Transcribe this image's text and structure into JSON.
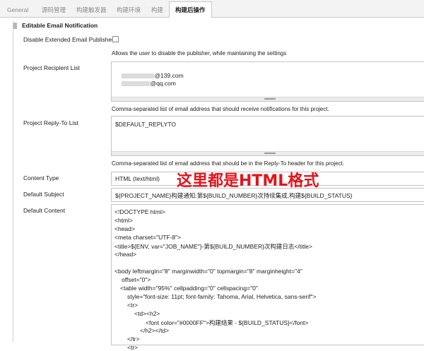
{
  "tabs": [
    {
      "label": "General",
      "active": false
    },
    {
      "label": "源码管理",
      "active": false
    },
    {
      "label": "构建触发器",
      "active": false
    },
    {
      "label": "构建环境",
      "active": false
    },
    {
      "label": "构建",
      "active": false
    },
    {
      "label": "构建后操作",
      "active": true
    }
  ],
  "section_title": "Editable Email Notification",
  "disable_publisher": {
    "label": "Disable Extended Email Publisher",
    "checked": false,
    "help": "Allows the user to disable the publisher, while maintaining the settings"
  },
  "recipient_list": {
    "label": "Project Recipient List",
    "lines": [
      "@139.com",
      "@qq.com"
    ],
    "help": "Comma-separated list of email address that should receive notifications for this project."
  },
  "reply_to": {
    "label": "Project Reply-To List",
    "value": "$DEFAULT_REPLYTO",
    "help": "Comma-separated list of email address that should be in the Reply-To header for this project."
  },
  "content_type": {
    "label": "Content Type",
    "value": "HTML (text/html)"
  },
  "annotation": "这里都是HTML格式",
  "default_subject": {
    "label": "Default Subject",
    "value": "${PROJECT_NAME}构建通知:第${BUILD_NUMBER}次持续集成,构建${BUILD_STATUS}"
  },
  "default_content": {
    "label": "Default Content",
    "lines": [
      "<!DOCTYPE html>",
      "<html>",
      "<head>",
      "<meta charset=\"UTF-8\">",
      "<title>${ENV, var=\"JOB_NAME\"}-第${BUILD_NUMBER}次构建日志</title>",
      "</head>",
      "",
      "<body leftmargin=\"8\" marginwidth=\"0\" topmargin=\"8\" marginheight=\"4\"",
      "offset=\"0\">",
      "<table width=\"95%\" cellpadding=\"0\" cellspacing=\"0\"",
      "style=\"font-size: 11pt; font-family: Tahoma, Arial, Helvetica, sans-serif\">",
      "<tr>",
      "<td><h2>",
      "<font color=\"#0000FF\">构建结果 - ${BUILD_STATUS}</font>",
      "</h2></td>",
      "</tr>",
      "<tr>"
    ]
  },
  "colors": {
    "annotation": "#e3141b",
    "tab_bar": "#f3f3f3",
    "border": "#c4c4c4"
  }
}
